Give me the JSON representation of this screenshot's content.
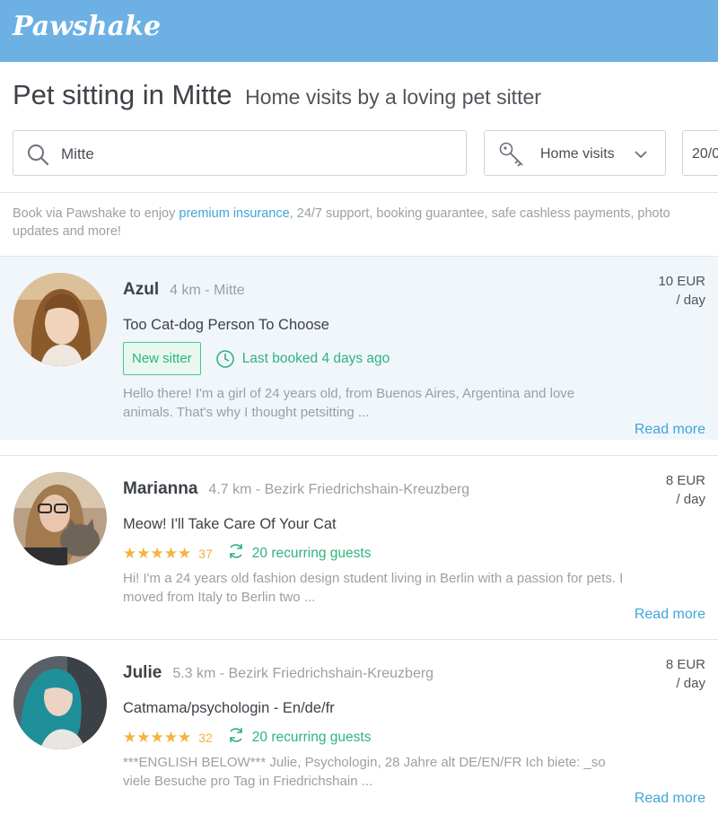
{
  "header": {
    "logo": "Pawshake",
    "brand_color": "#6db1e4"
  },
  "page": {
    "title": "Pet sitting in Mitte",
    "subtitle": "Home visits by a loving pet sitter"
  },
  "search": {
    "location_value": "Mitte",
    "service": "Home visits",
    "date_partial": "20/0"
  },
  "info": {
    "prefix": "Book via Pawshake to enjoy ",
    "link": "premium insurance",
    "suffix": ", 24/7 support, booking guarantee, safe cashless payments, photo updates and more!"
  },
  "sitters": [
    {
      "name": "Azul",
      "distance": "4 km - Mitte",
      "headline": "Too Cat-dog Person To Choose",
      "badge": "New sitter",
      "last_booked": "Last booked 4 days ago",
      "description": "Hello there! I'm a girl of 24 years old, from Buenos Aires, Argentina and love animals. That's why I thought petsitting ...",
      "price": "10 EUR",
      "unit": "/ day",
      "read_more": "Read more"
    },
    {
      "name": "Marianna",
      "distance": "4.7 km - Bezirk Friedrichshain-Kreuzberg",
      "headline": "Meow! I'll Take Care Of Your Cat",
      "stars": "★★★★★",
      "rating": 5,
      "review_count": "37",
      "guests": "20 recurring guests",
      "description": "Hi! I'm a 24 years old fashion design student living in Berlin with a passion for pets. I moved from Italy to Berlin two ...",
      "price": "8 EUR",
      "unit": "/ day",
      "read_more": "Read more"
    },
    {
      "name": "Julie",
      "distance": "5.3 km - Bezirk Friedrichshain-Kreuzberg",
      "headline": "Catmama/psychologin - En/de/fr",
      "stars": "★★★★★",
      "rating": 5,
      "review_count": "32",
      "guests": "20 recurring guests",
      "description": "***ENGLISH BELOW*** Julie, Psychologin, 28 Jahre alt DE/EN/FR Ich biete: _so viele Besuche pro Tag in Friedrichshain ...",
      "price": "8 EUR",
      "unit": "/ day",
      "read_more": "Read more"
    }
  ]
}
